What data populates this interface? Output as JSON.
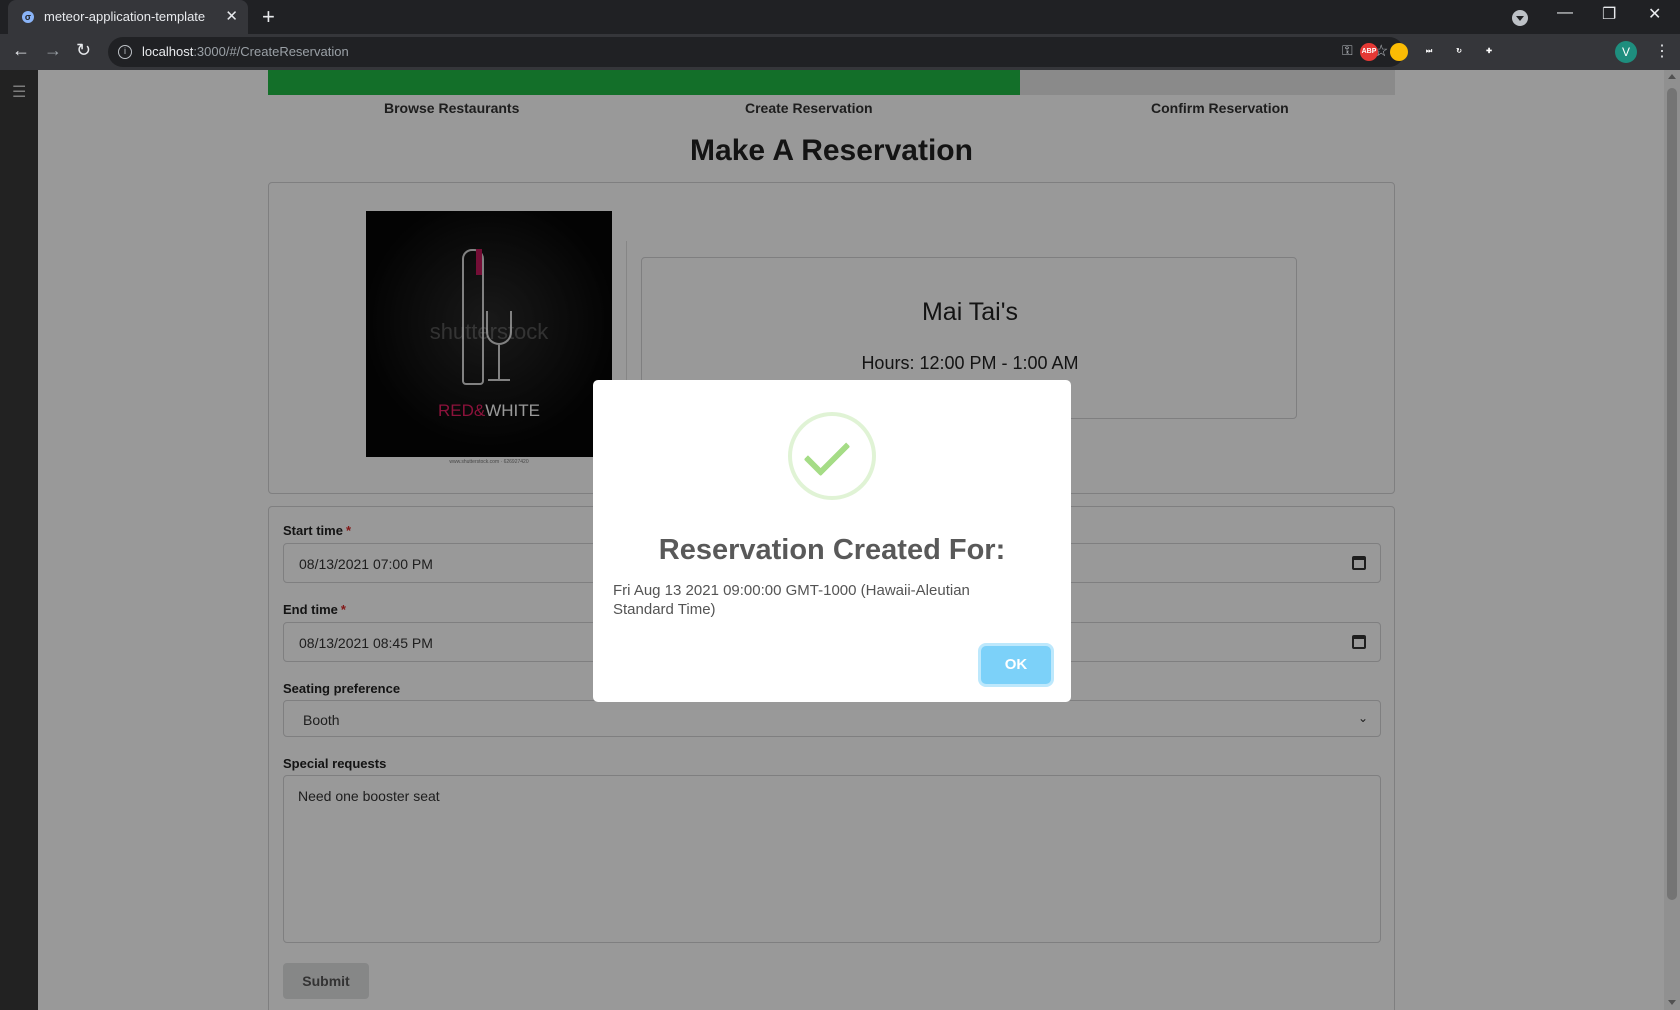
{
  "browser": {
    "tab_title": "meteor-application-template",
    "favicon_glyph": "σ",
    "close_tab_glyph": "✕",
    "new_tab_glyph": "+",
    "url_host": "localhost",
    "url_path": ":3000/#/CreateReservation",
    "info_glyph": "i",
    "key_glyph": "⚿",
    "star_glyph": "☆",
    "minimize_glyph": "—",
    "restore_glyph": "❐",
    "close_glyph": "✕",
    "back_glyph": "←",
    "forward_glyph": "→",
    "reload_glyph": "↻",
    "extensions": [
      {
        "name": "adblock-extension",
        "label": "ABP",
        "color": "#e53935"
      },
      {
        "name": "chrome-extension",
        "label": "",
        "color": "#fbbc04"
      },
      {
        "name": "media-extension",
        "label": "⏭",
        "color": "#35363a"
      },
      {
        "name": "sync-extension",
        "label": "↻",
        "color": "#35363a"
      },
      {
        "name": "puzzle-extension",
        "label": "✚",
        "color": "#35363a"
      }
    ],
    "avatar_letter": "V",
    "menu_glyph": "⋮"
  },
  "sidebar": {
    "menu_glyph": "☰"
  },
  "progress": {
    "fill_fraction": 0.667,
    "fill_color": "#21ba45",
    "steps": [
      "Browse Restaurants",
      "Create Reservation",
      "Confirm Reservation"
    ]
  },
  "page": {
    "heading": "Make A Reservation"
  },
  "restaurant": {
    "name": "Mai Tai's",
    "hours": "Hours: 12:00 PM - 1:00 AM",
    "image": {
      "watermark": "shutterstock",
      "brand_red": "RED&",
      "brand_white": "WHITE",
      "caption": "www.shutterstock.com · 626927420"
    }
  },
  "form": {
    "start_label": "Start time",
    "start_value": "08/13/2021 07:00 PM",
    "end_label": "End time",
    "end_value": "08/13/2021 08:45 PM",
    "required_mark": "*",
    "seating_label": "Seating preference",
    "seating_value": "Booth",
    "requests_label": "Special requests",
    "requests_value": "Need one booster seat",
    "submit_label": "Submit",
    "chevron_glyph": "⌄"
  },
  "modal": {
    "title": "Reservation Created For:",
    "text": "Fri Aug 13 2021 09:00:00 GMT-1000 (Hawaii-Aleutian Standard Time)",
    "ok_label": "OK",
    "icon_color": "#a5dc86",
    "button_color": "#7cd1f9"
  }
}
